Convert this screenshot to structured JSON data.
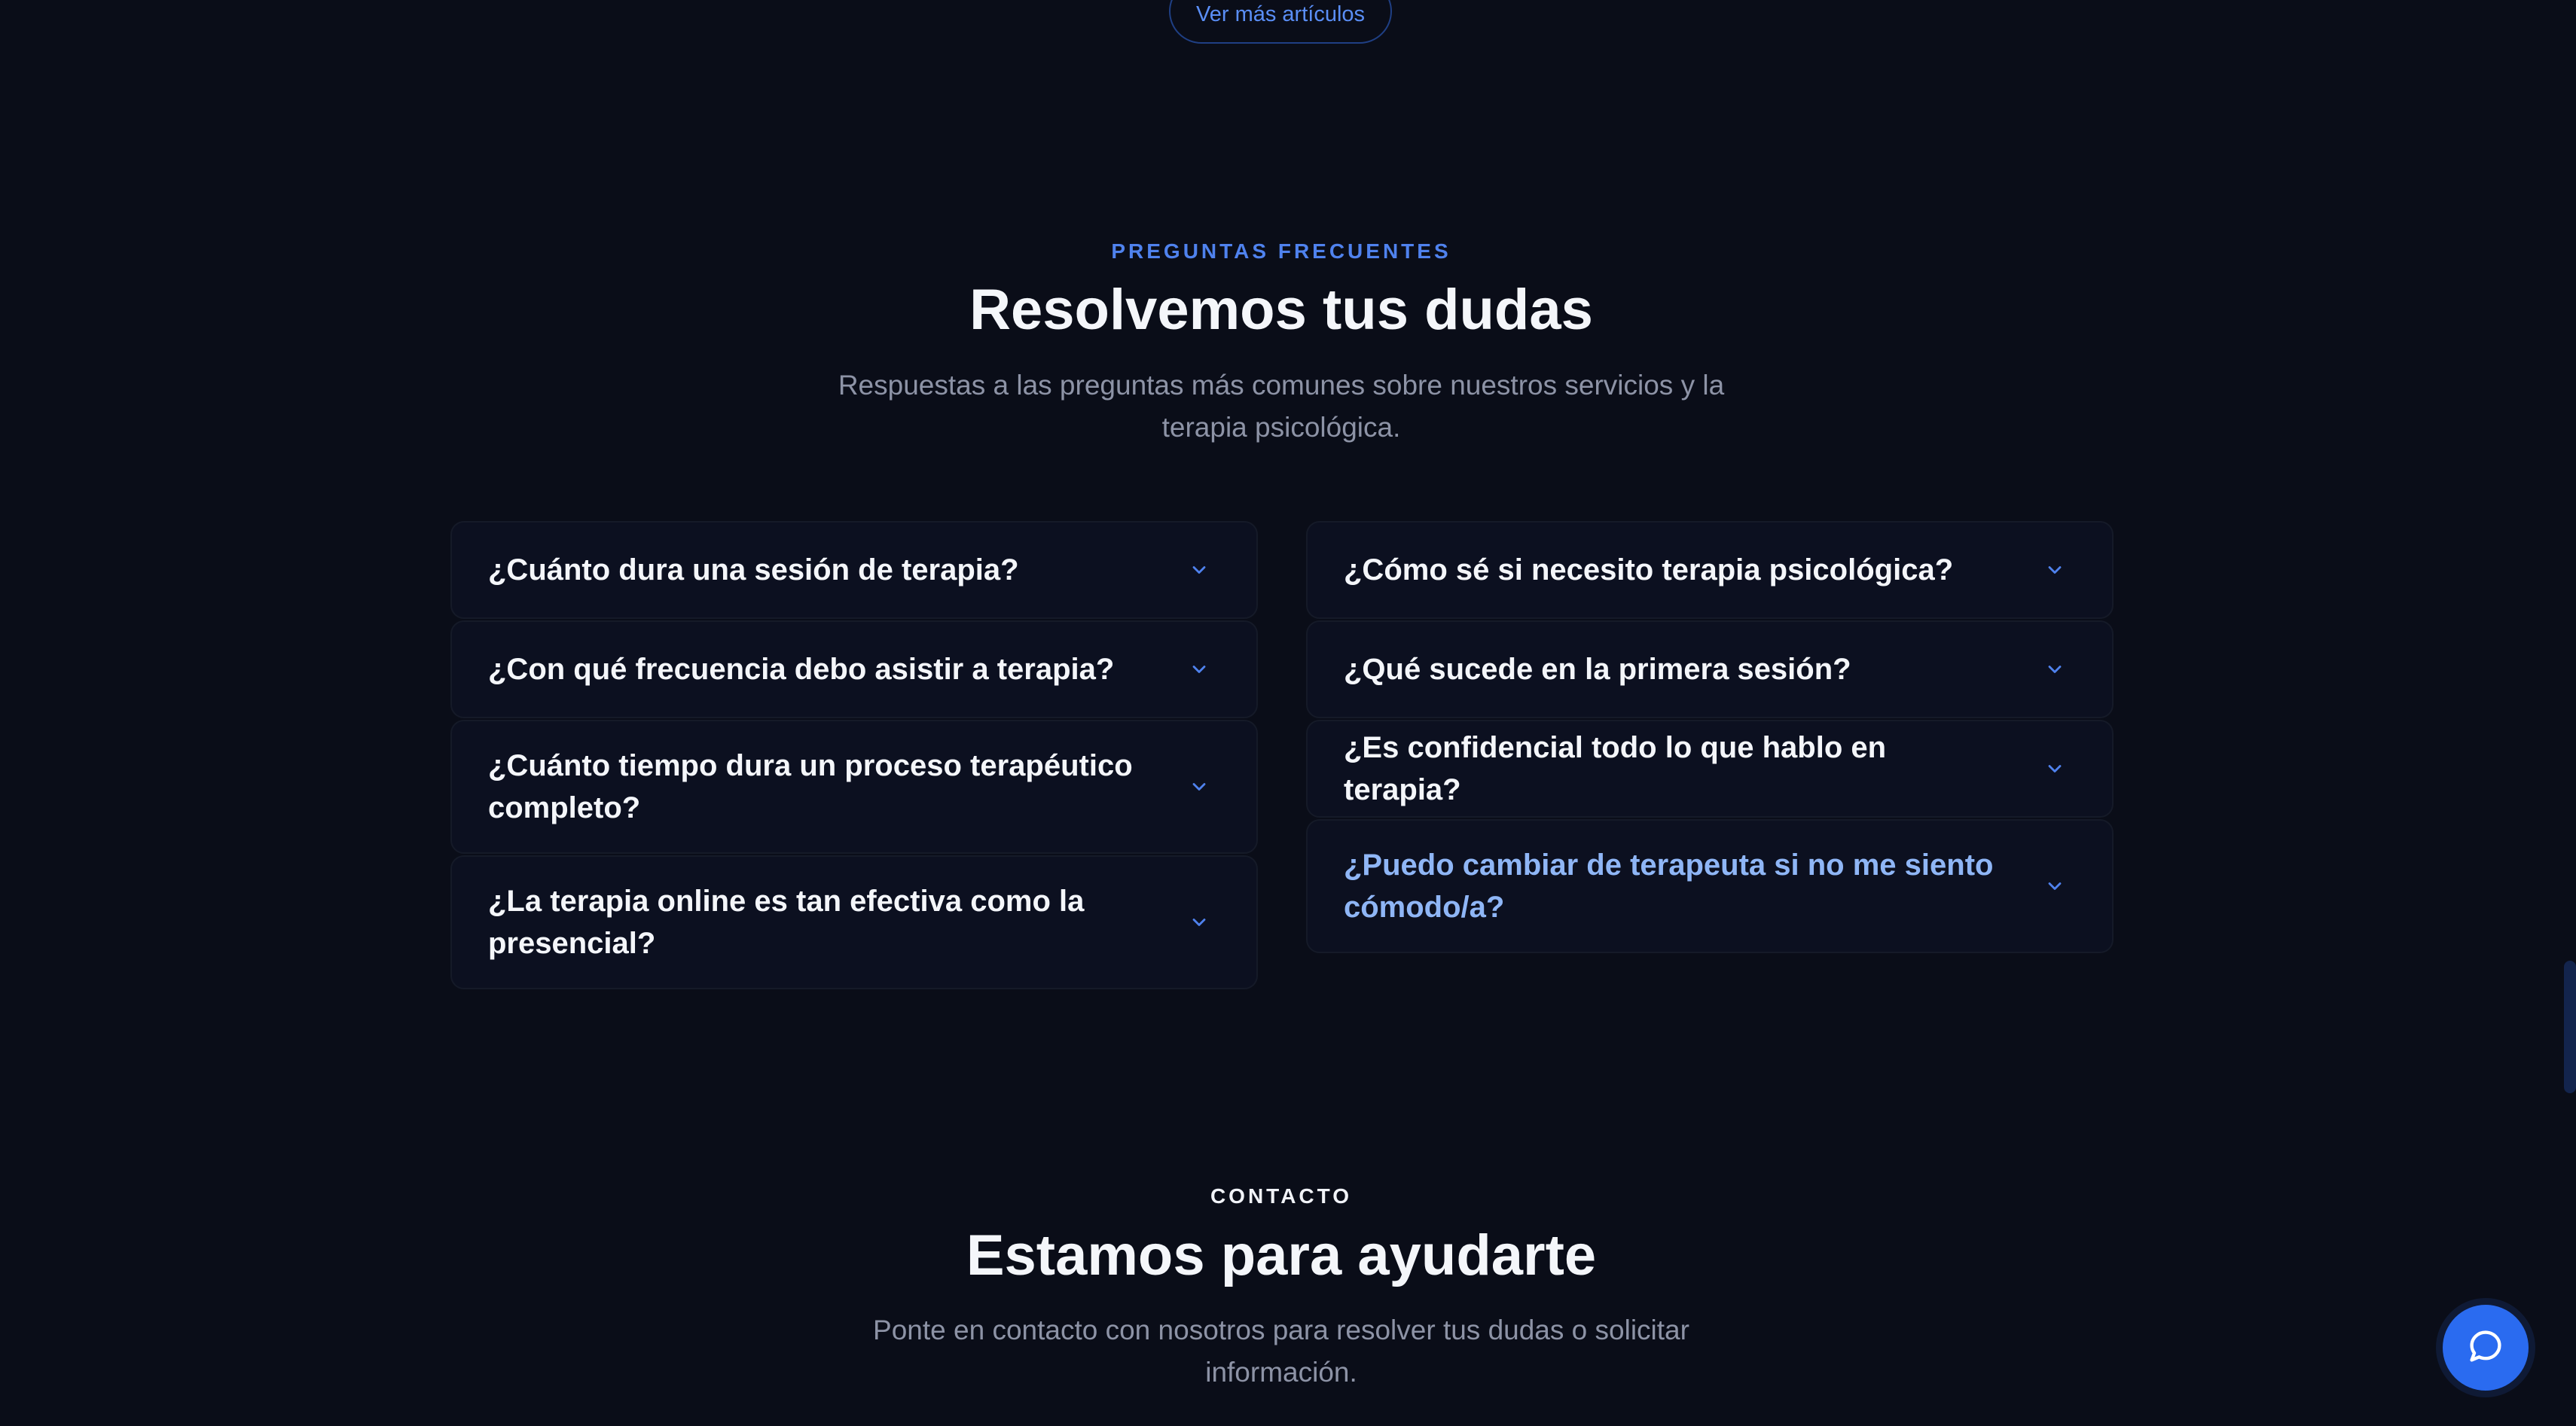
{
  "top_link": {
    "label": "Ver más artículos"
  },
  "faq": {
    "eyebrow": "PREGUNTAS FRECUENTES",
    "title": "Resolvemos tus dudas",
    "subtitle": "Respuestas a las preguntas más comunes sobre nuestros servicios y la terapia psicológica.",
    "left_items": [
      {
        "question": "¿Cuánto dura una sesión de terapia?"
      },
      {
        "question": "¿Con qué frecuencia debo asistir a terapia?"
      },
      {
        "question": "¿Cuánto tiempo dura un proceso terapéutico completo?"
      },
      {
        "question": "¿La terapia online es tan efectiva como la presencial?"
      }
    ],
    "right_items": [
      {
        "question": "¿Cómo sé si necesito terapia psicológica?"
      },
      {
        "question": "¿Qué sucede en la primera sesión?"
      },
      {
        "question": "¿Es confidencial todo lo que hablo en terapia?"
      },
      {
        "question": "¿Puedo cambiar de terapeuta si no me siento cómodo/a?",
        "state": "hover"
      }
    ]
  },
  "contact": {
    "eyebrow": "CONTACTO",
    "title": "Estamos para ayudarte",
    "subtitle": "Ponte en contacto con nosotros para resolver tus dudas o solicitar información."
  },
  "icons": {
    "faq_toggle": "chevron-down-icon",
    "chat": "chat-bubble-icon"
  },
  "colors": {
    "background": "#0a0d18",
    "accent": "#4f82ee",
    "active_question": "#8fb6f6",
    "chat_button": "#2a6bf0"
  }
}
